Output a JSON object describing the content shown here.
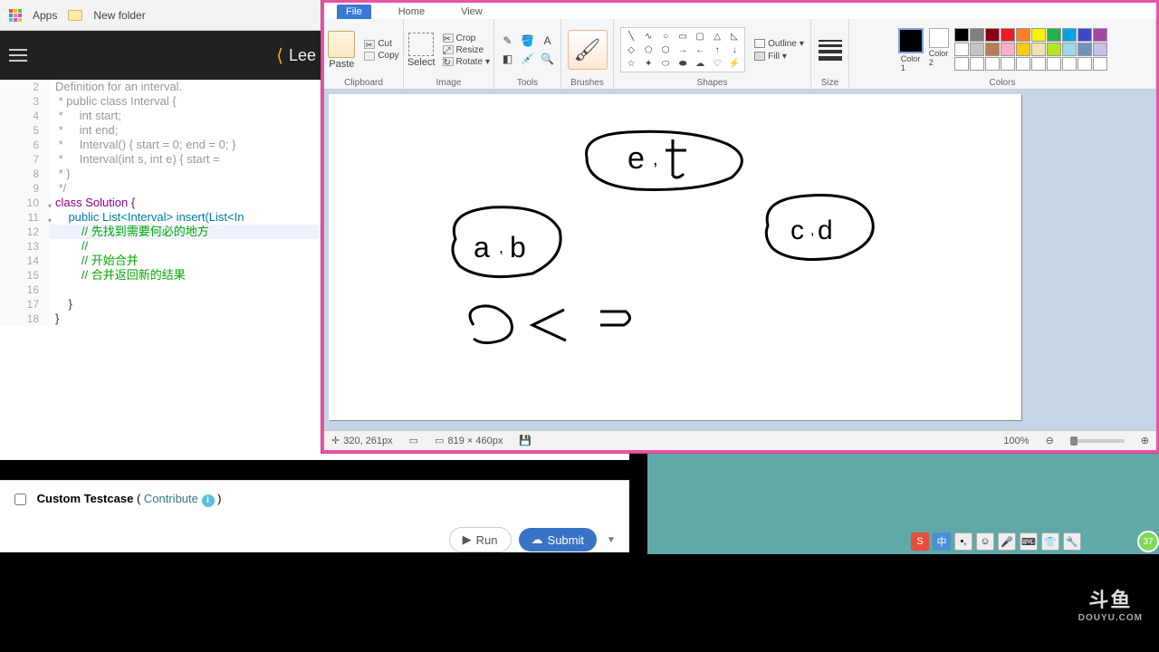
{
  "browser": {
    "apps": "Apps",
    "newfolder": "New folder"
  },
  "leetcode": {
    "logo": "Lee"
  },
  "code": {
    "lines": [
      {
        "n": "2",
        "t": "Definition for an interval.",
        "cls": "cm"
      },
      {
        "n": "3",
        "t": " * public class Interval {",
        "cls": "cm"
      },
      {
        "n": "4",
        "t": " *     int start;",
        "cls": "cm"
      },
      {
        "n": "5",
        "t": " *     int end;",
        "cls": "cm"
      },
      {
        "n": "6",
        "t": " *     Interval() { start = 0; end = 0; }",
        "cls": "cm"
      },
      {
        "n": "7",
        "t": " *     Interval(int s, int e) { start = ",
        "cls": "cm"
      },
      {
        "n": "8",
        "t": " * }",
        "cls": "cm"
      },
      {
        "n": "9",
        "t": " */",
        "cls": "cm"
      },
      {
        "n": "10",
        "t": "class Solution {",
        "cls": "kw",
        "fold": true
      },
      {
        "n": "11",
        "t": "    public List<Interval> insert(List<In",
        "cls": "ty",
        "fold": true
      },
      {
        "n": "12",
        "t": "        // 先找到需要何必的地方",
        "cls": "cmnt",
        "hl": true
      },
      {
        "n": "13",
        "t": "        //",
        "cls": "cmnt"
      },
      {
        "n": "14",
        "t": "        // 开始合并",
        "cls": "cmnt"
      },
      {
        "n": "15",
        "t": "        // 合并返回新的结果",
        "cls": "cmnt"
      },
      {
        "n": "16",
        "t": "",
        "cls": ""
      },
      {
        "n": "17",
        "t": "    }",
        "cls": ""
      },
      {
        "n": "18",
        "t": "}",
        "cls": ""
      }
    ]
  },
  "testcase": {
    "label": "Custom Testcase",
    "contribute": "Contribute",
    "run": "Run",
    "submit": "Submit"
  },
  "paint": {
    "tabs": {
      "file": "File",
      "home": "Home",
      "view": "View"
    },
    "clipboard": {
      "paste": "Paste",
      "cut": "Cut",
      "copy": "Copy",
      "label": "Clipboard"
    },
    "image": {
      "select": "Select",
      "crop": "Crop",
      "resize": "Resize",
      "rotate": "Rotate",
      "label": "Image"
    },
    "tools": {
      "label": "Tools"
    },
    "brushes": {
      "label": "Brushes"
    },
    "shapes": {
      "outline": "Outline",
      "fill": "Fill",
      "label": "Shapes"
    },
    "size": {
      "label": "Size"
    },
    "colors": {
      "color1": "Color\n1",
      "color2": "Color\n2",
      "label": "Colors"
    },
    "status": {
      "pos": "320, 261px",
      "dim": "819 × 460px",
      "zoom": "100%"
    }
  },
  "palette": [
    "#000",
    "#7f7f7f",
    "#880015",
    "#ed1c24",
    "#ff7f27",
    "#fff200",
    "#22b14c",
    "#00a2e8",
    "#3f48cc",
    "#a349a4",
    "#fff",
    "#c3c3c3",
    "#b97a57",
    "#ffaec9",
    "#ffc90e",
    "#efe4b0",
    "#b5e61d",
    "#99d9ea",
    "#7092be",
    "#c8bfe7",
    "#fff",
    "#fff",
    "#fff",
    "#fff",
    "#fff",
    "#fff",
    "#fff",
    "#fff",
    "#fff",
    "#fff"
  ],
  "douyu": {
    "cn": "斗鱼",
    "en": "DOUYU.COM"
  },
  "green": "37"
}
